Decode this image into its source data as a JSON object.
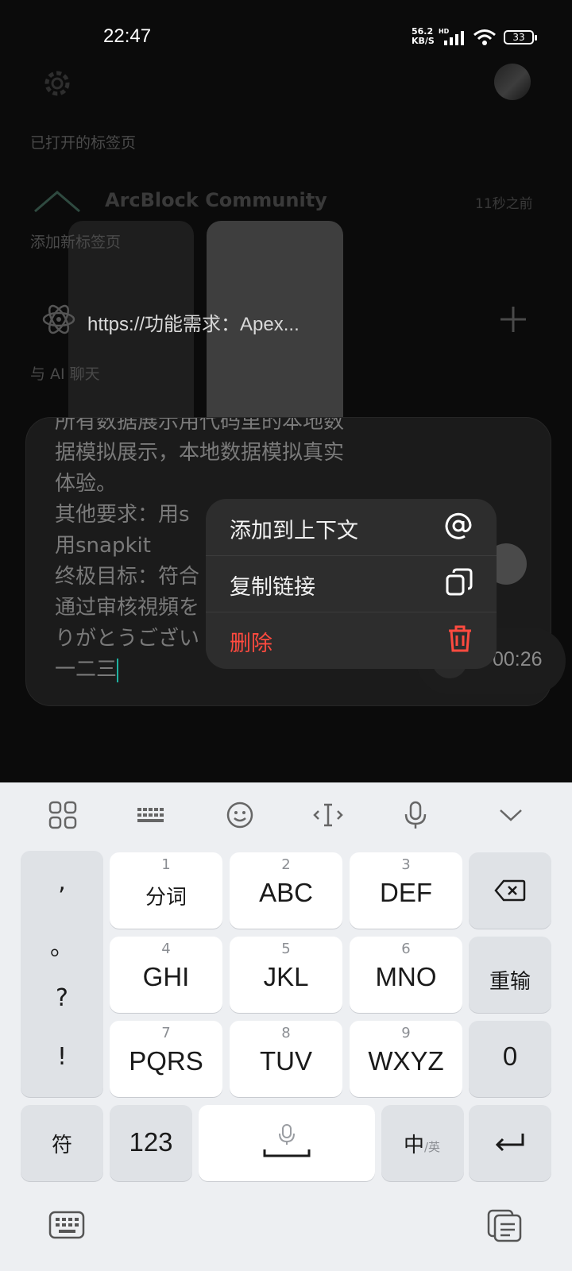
{
  "status_bar": {
    "time": "22:47",
    "net_speed": "56.2",
    "net_unit": "KB/S",
    "hd": "HD",
    "battery": "33"
  },
  "sections": {
    "open_tabs": "已打开的标签页",
    "add_new_tab": "添加新标签页",
    "chat_ai": "与 AI 聊天"
  },
  "tab": {
    "title": "ArcBlock Community",
    "time": "11秒之前"
  },
  "url_suggest": {
    "text": "https://功能需求：Apex..."
  },
  "chat": {
    "lines": [
      "所有数据展示用代码里的本地数",
      "据模拟展示，本地数据模拟真实",
      "体验。",
      "其他要求：用s",
      "用snapkit",
      "终极目标：符合",
      "通过审核視頻を",
      "りがとうござい",
      "一二三"
    ]
  },
  "recording": {
    "duration": "00:26"
  },
  "context_menu": {
    "items": [
      {
        "label": "添加到上下文",
        "icon": "at-icon"
      },
      {
        "label": "复制链接",
        "icon": "copy-icon"
      },
      {
        "label": "删除",
        "icon": "trash-icon"
      }
    ]
  },
  "keyboard": {
    "punct": [
      ",",
      "。",
      "?",
      "!"
    ],
    "rows": [
      [
        {
          "num": "1",
          "label": "分词"
        },
        {
          "num": "2",
          "label": "ABC"
        },
        {
          "num": "3",
          "label": "DEF"
        }
      ],
      [
        {
          "num": "4",
          "label": "GHI"
        },
        {
          "num": "5",
          "label": "JKL"
        },
        {
          "num": "6",
          "label": "MNO"
        }
      ],
      [
        {
          "num": "7",
          "label": "PQRS"
        },
        {
          "num": "8",
          "label": "TUV"
        },
        {
          "num": "9",
          "label": "WXYZ"
        }
      ]
    ],
    "retype": "重输",
    "zero": "0",
    "symbols": "符",
    "numbers": "123",
    "lang_main": "中",
    "lang_alt": "/英"
  },
  "colors": {
    "danger": "#ff4a3f",
    "caret": "#1fb1a0"
  }
}
